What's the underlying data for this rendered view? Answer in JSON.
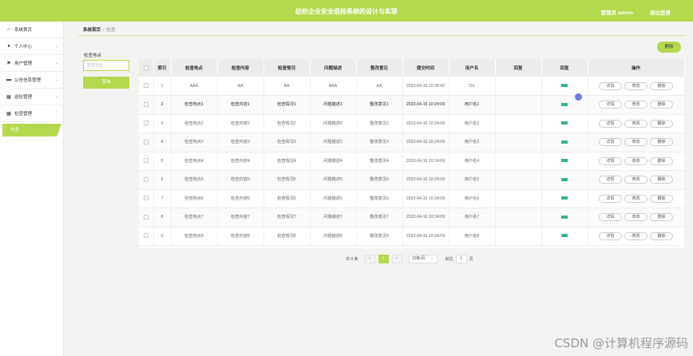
{
  "header": {
    "title": "纺织企业安全巡检系统的设计与实现",
    "user": "管理员 admin",
    "logout": "退出登录"
  },
  "sidebar": {
    "items": [
      {
        "label": "系统首页",
        "icon": "home-icon"
      },
      {
        "label": "个人中心",
        "icon": "person-icon"
      },
      {
        "label": "用户管理",
        "icon": "flag-icon"
      },
      {
        "label": "公告信息管理",
        "icon": "monitor-icon"
      },
      {
        "label": "巡检管理",
        "icon": "grid-icon"
      },
      {
        "label": "检查管理",
        "icon": "grid-icon"
      }
    ],
    "submenu_selected": "检查"
  },
  "breadcrumb": {
    "home": "系统首页",
    "sep": "/",
    "current": "检查"
  },
  "toolbar": {
    "delete_label": "删除"
  },
  "search": {
    "label": "检查地点",
    "placeholder": "检查地点",
    "button": "查询"
  },
  "table": {
    "columns": [
      "索引",
      "检查地点",
      "检查内容",
      "检查情况",
      "问题描述",
      "整改意见",
      "提交时间",
      "用户名",
      "回复",
      "回复",
      "操作"
    ],
    "rows": [
      [
        "1",
        "AAA",
        "AA",
        "AA",
        "AAA",
        "AA",
        "2023-04-16 10:30:42",
        "111",
        "",
        ""
      ],
      [
        "2",
        "检查地点1",
        "检查内容1",
        "检查情况1",
        "问题描述1",
        "整改意见1",
        "2023-04-16 10:24:09",
        "用户名1",
        "",
        ""
      ],
      [
        "3",
        "检查地点2",
        "检查内容2",
        "检查情况2",
        "问题描述2",
        "整改意见2",
        "2023-04-16 10:24:09",
        "用户名2",
        "",
        ""
      ],
      [
        "4",
        "检查地点3",
        "检查内容3",
        "检查情况3",
        "问题描述3",
        "整改意见3",
        "2023-04-16 10:24:09",
        "用户名3",
        "",
        ""
      ],
      [
        "5",
        "检查地点4",
        "检查内容4",
        "检查情况4",
        "问题描述4",
        "整改意见4",
        "2023-04-16 10:24:09",
        "用户名4",
        "",
        ""
      ],
      [
        "6",
        "检查地点5",
        "检查内容5",
        "检查情况5",
        "问题描述5",
        "整改意见5",
        "2023-04-16 10:24:09",
        "用户名5",
        "",
        ""
      ],
      [
        "7",
        "检查地点6",
        "检查内容6",
        "检查情况6",
        "问题描述6",
        "整改意见6",
        "2023-04-16 10:24:09",
        "用户名6",
        "",
        ""
      ],
      [
        "8",
        "检查地点7",
        "检查内容7",
        "检查情况7",
        "问题描述7",
        "整改意见7",
        "2023-04-16 10:24:09",
        "用户名7",
        "",
        ""
      ],
      [
        "9",
        "检查地点8",
        "检查内容8",
        "检查情况8",
        "问题描述8",
        "整改意见8",
        "2023-04-16 10:24:09",
        "用户名8",
        "",
        ""
      ]
    ],
    "op_labels": [
      "详情",
      "修改",
      "删除"
    ]
  },
  "pager": {
    "total": "共 9 条",
    "prev": "<",
    "current": "1",
    "next": ">",
    "page_size": "10条/页",
    "goto_label": "前往",
    "goto_value": "1",
    "goto_suffix": "页"
  },
  "watermark": "CSDN @计算机程序源码",
  "colors": {
    "accent": "#b4d84e",
    "reply_image": "#38b48b"
  }
}
